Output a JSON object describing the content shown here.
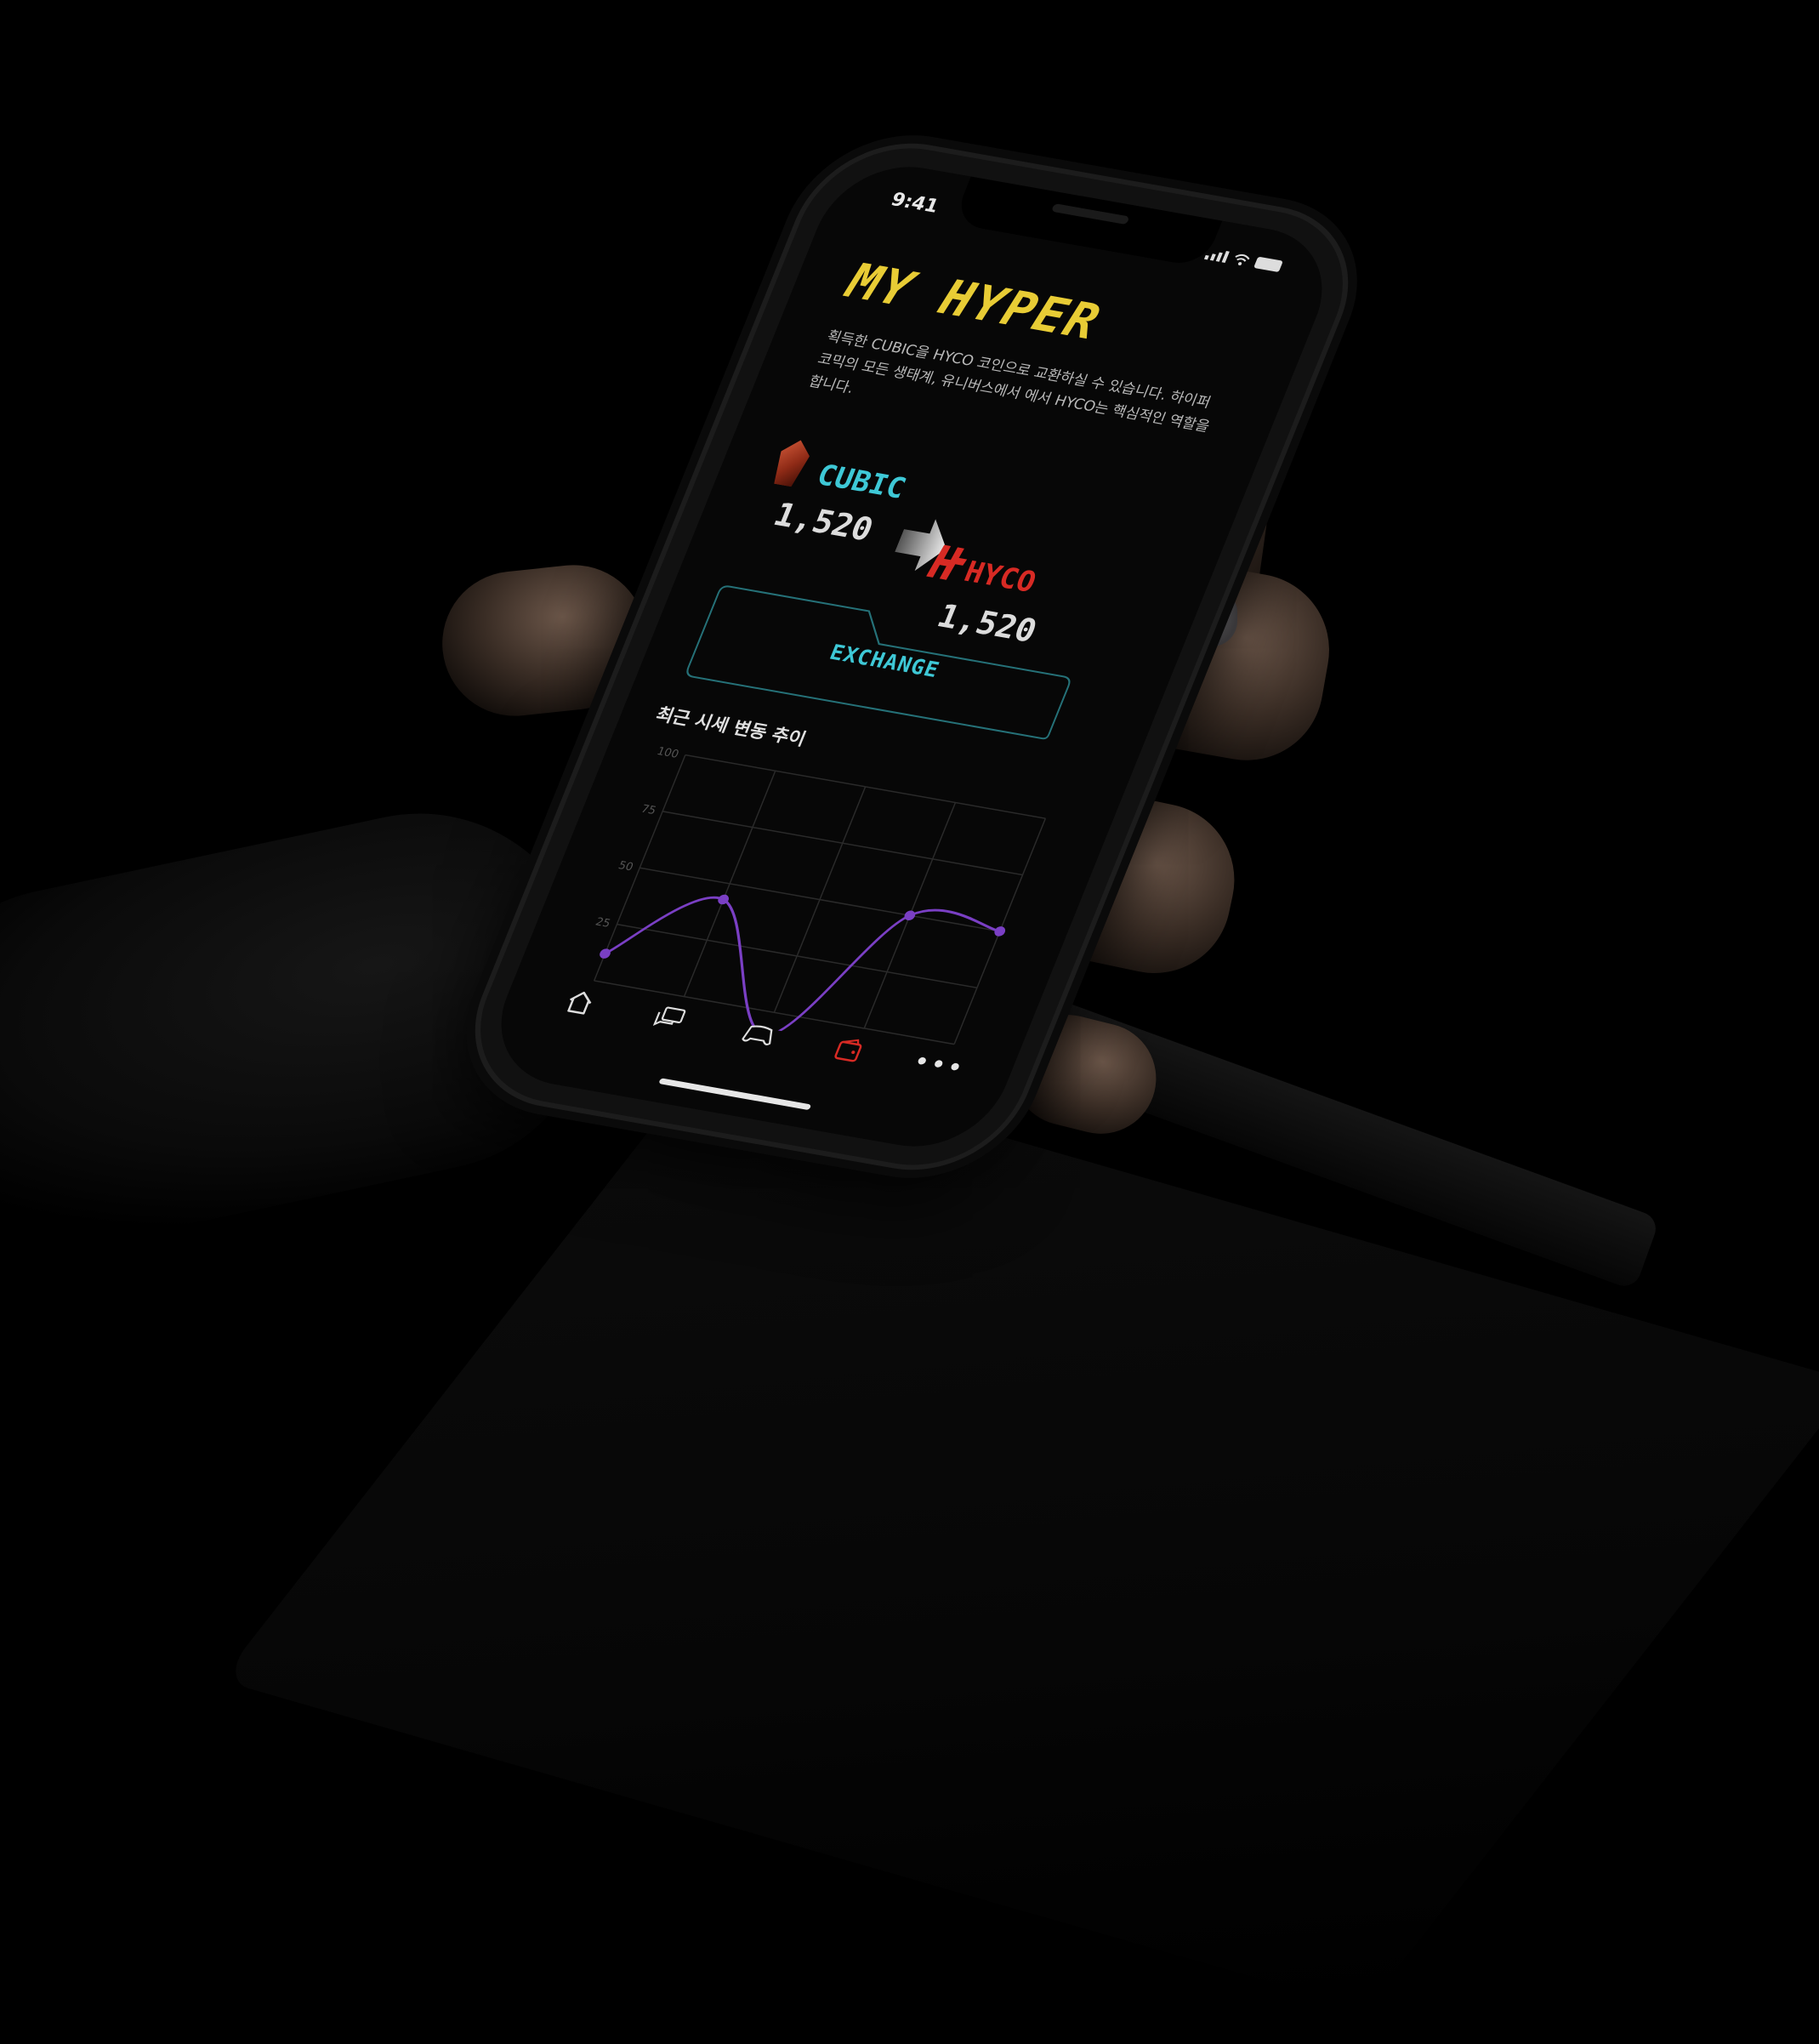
{
  "status_bar": {
    "time": "9:41"
  },
  "header": {
    "title": "MY HYPER"
  },
  "description": "획득한 CUBIC을 HYCO 코인으로 교환하실 수 있습니다. 하이퍼코믹의 모든 생태계, 유니버스에서 에서 HYCO는 핵심적인 역할을 합니다.",
  "exchange": {
    "from": {
      "name": "CUBIC",
      "amount": "1,520",
      "color": "#3ec8d6",
      "icon": "cubic-gem-icon"
    },
    "to": {
      "name": "HYCO",
      "amount": "1,520",
      "color": "#d72a24",
      "icon": "hyco-logo-icon"
    },
    "button_label": "EXCHANGE"
  },
  "chart_section": {
    "title": "최근 시세 변동 추이"
  },
  "chart_data": {
    "type": "line",
    "ylim": [
      0,
      100
    ],
    "yticks": [
      "100",
      "75",
      "50",
      "25"
    ],
    "grid": true,
    "line_color": "#7a3fc4",
    "series": [
      {
        "values": [
          12,
          43,
          -10,
          50,
          50
        ]
      }
    ]
  },
  "tabbar": {
    "items": [
      {
        "icon": "home-icon"
      },
      {
        "icon": "chat-icon"
      },
      {
        "icon": "gamepad-icon"
      },
      {
        "icon": "wallet-icon",
        "active": true,
        "active_color": "#d72a24"
      },
      {
        "icon": "more-icon"
      }
    ]
  }
}
